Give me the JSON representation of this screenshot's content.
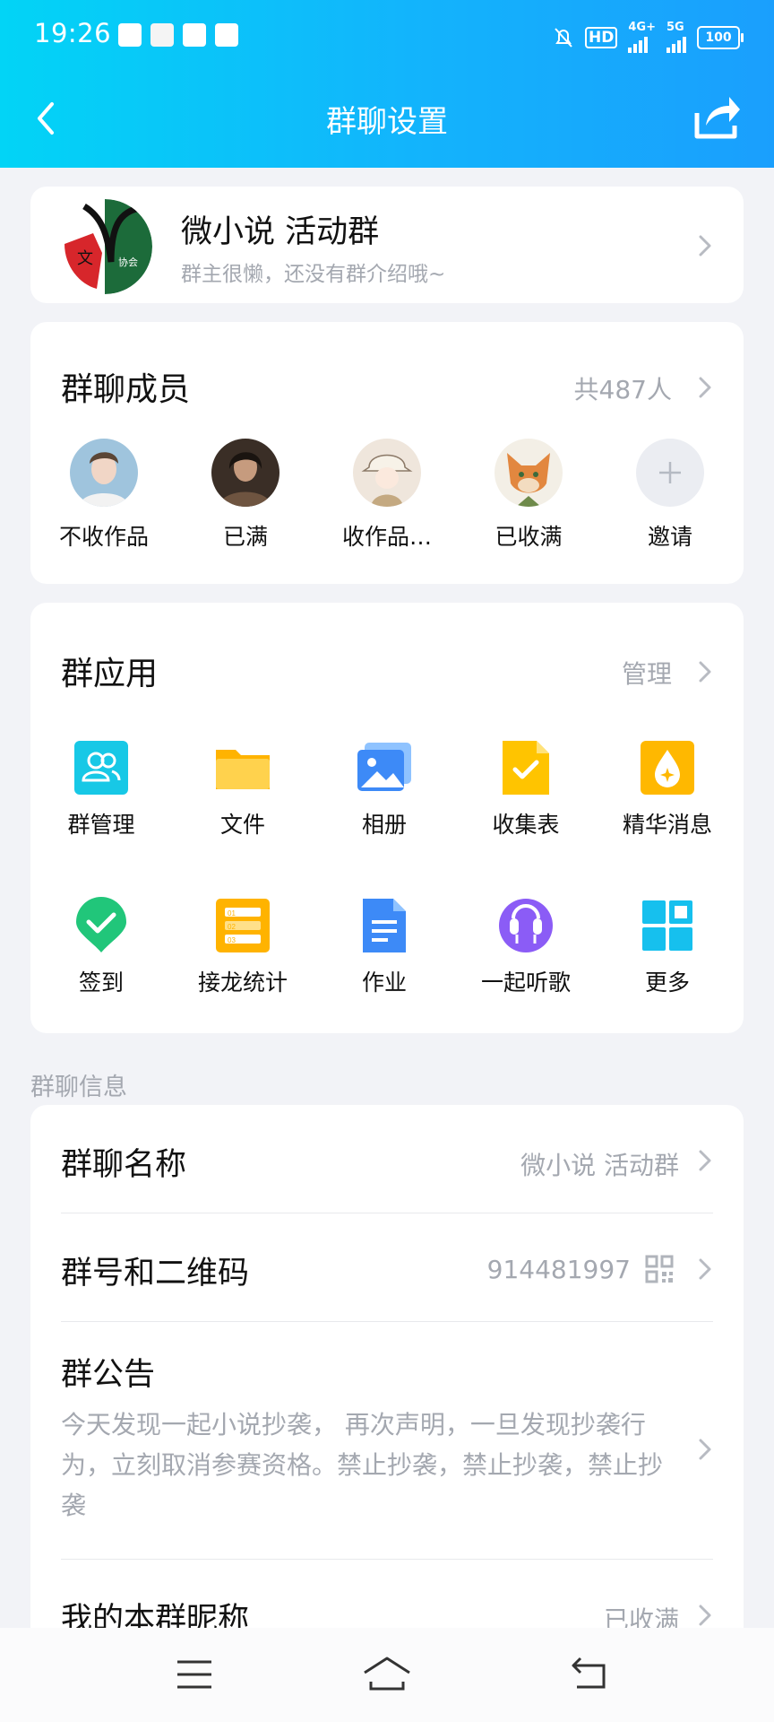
{
  "status_bar": {
    "time": "19:26",
    "hd": "HD",
    "net1": "4G+",
    "net2": "5G",
    "battery": "100"
  },
  "nav": {
    "title": "群聊设置",
    "back_icon": "chevron-left-icon",
    "share_icon": "share-icon"
  },
  "group": {
    "name": "微小说 活动群",
    "desc": "群主很懒，还没有群介绍哦~"
  },
  "members": {
    "title": "群聊成员",
    "count": "共487人",
    "list": [
      {
        "name": "不收作品"
      },
      {
        "name": "已满"
      },
      {
        "name": "收作品…"
      },
      {
        "name": "已收满"
      },
      {
        "name": "邀请"
      }
    ]
  },
  "apps": {
    "title": "群应用",
    "manage": "管理",
    "items": [
      {
        "name": "群管理",
        "icon": "group-manage-icon"
      },
      {
        "name": "文件",
        "icon": "folder-icon"
      },
      {
        "name": "相册",
        "icon": "album-icon"
      },
      {
        "name": "收集表",
        "icon": "form-icon"
      },
      {
        "name": "精华消息",
        "icon": "essence-icon"
      },
      {
        "name": "签到",
        "icon": "checkin-icon"
      },
      {
        "name": "接龙统计",
        "icon": "solitaire-icon"
      },
      {
        "name": "作业",
        "icon": "homework-icon"
      },
      {
        "name": "一起听歌",
        "icon": "headphones-icon"
      },
      {
        "name": "更多",
        "icon": "grid-icon"
      }
    ]
  },
  "info": {
    "section_label": "群聊信息",
    "name_label": "群聊名称",
    "name_value": "微小说 活动群",
    "id_label": "群号和二维码",
    "id_value": "914481997",
    "notice_label": "群公告",
    "notice_text": "今天发现一起小说抄袭， 再次声明，一旦发现抄袭行为，立刻取消参赛资格。禁止抄袭，禁止抄袭，禁止抄袭",
    "nick_label": "我的本群昵称",
    "nick_value": "已收满"
  },
  "colors": {
    "header_start": "#02d4f6",
    "header_end": "#1a9ffd",
    "background": "#f2f3f7",
    "secondary_text": "#a4a8b0"
  }
}
